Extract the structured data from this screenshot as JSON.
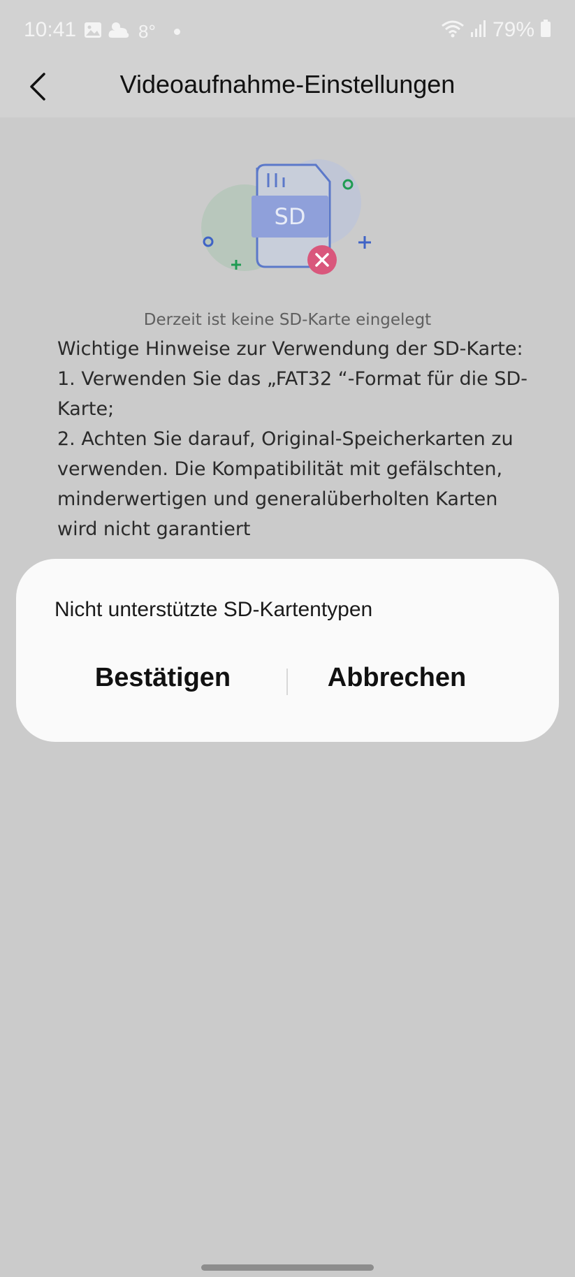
{
  "status_bar": {
    "time": "10:41",
    "temperature": "8°",
    "battery_percent": "79%",
    "icons": [
      "image-icon",
      "cloudy-icon",
      "notification-dot",
      "wifi-icon",
      "signal-icon",
      "battery-icon"
    ]
  },
  "header": {
    "title": "Videoaufnahme-Einstellungen",
    "back_icon": "chevron-left-icon"
  },
  "content": {
    "illustration_icon": "sd-card-missing-icon",
    "illustration_label": "SD",
    "no_card_text": "Derzeit ist keine SD-Karte eingelegt",
    "notes": [
      "Wichtige Hinweise zur Verwendung der SD-Karte:",
      "1. Verwenden Sie das „FAT32 “-Format für die SD-Karte;",
      "2. Achten Sie darauf, Original-Speicherkarten zu verwenden. Die Kompatibilität mit gefälschten, minderwertigen und generalüberholten Karten wird nicht garantiert"
    ]
  },
  "dialog": {
    "message": "Nicht unterstützte SD-Kartentypen",
    "confirm_label": "Bestätigen",
    "cancel_label": "Abbrechen"
  },
  "colors": {
    "overlay_background": "#cbcbcb",
    "header_background": "#d2d2d2",
    "dialog_background": "#fafafa",
    "sd_card_blue": "#8fa0da",
    "sd_card_outline": "#5b78c9",
    "error_red": "#d9577c",
    "green_circle": "#b3c9b7",
    "blue_circle": "#bfc5d6",
    "green_accent": "#1f9b52"
  }
}
